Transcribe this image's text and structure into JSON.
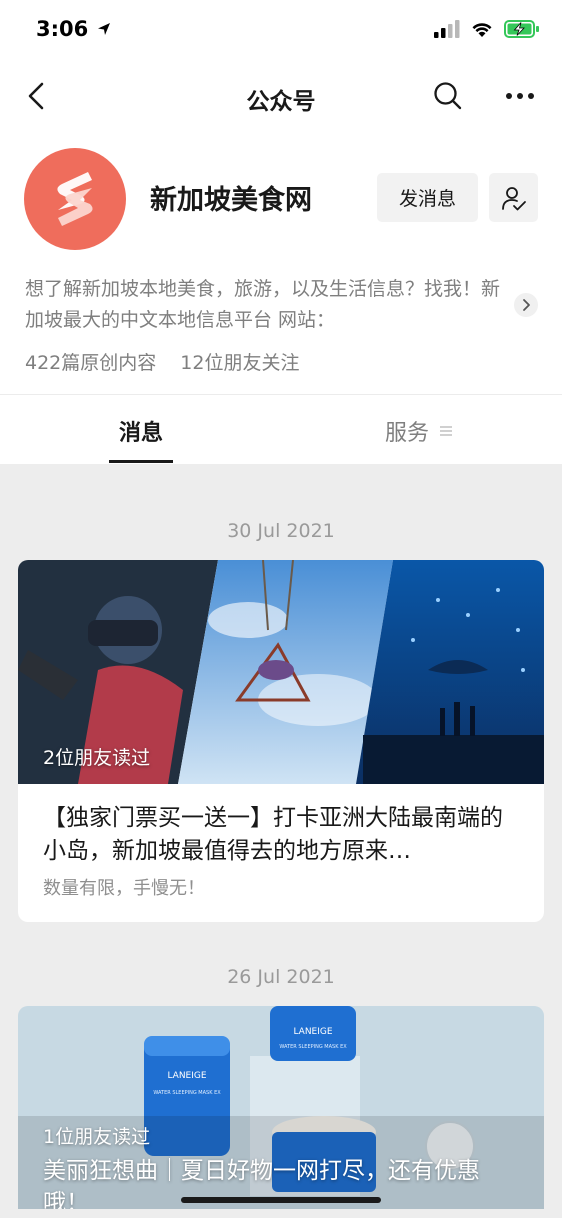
{
  "status_bar": {
    "time": "3:06"
  },
  "nav": {
    "title": "公众号"
  },
  "profile": {
    "name": "新加坡美食网",
    "send_message_label": "发消息",
    "description": "想了解新加坡本地美食，旅游，以及生活信息？找我！新加坡最大的中文本地信息平台 网站：www.xinjiapomeishi.com",
    "original_count": "422篇原创内容",
    "friends_follow": "12位朋友关注"
  },
  "tabs": [
    {
      "label": "消息"
    },
    {
      "label": "服务"
    }
  ],
  "feed": [
    {
      "date": "30 Jul 2021",
      "read_by": "2位朋友读过",
      "title": "【独家门票买一送一】打卡亚洲大陆最南端的小岛，新加坡最值得去的地方原来…",
      "digest": "数量有限，手慢无！"
    },
    {
      "date": "26 Jul 2021",
      "read_by": "1位朋友读过",
      "title": "美丽狂想曲｜夏日好物一网打尽，还有优惠哦！",
      "product_brand": "LANEIGE",
      "product_name": "WATER SLEEPING MASK EX"
    }
  ],
  "colors": {
    "brand_avatar": "#ef6d5c",
    "background": "#ededed",
    "battery_charging": "#34c759"
  }
}
